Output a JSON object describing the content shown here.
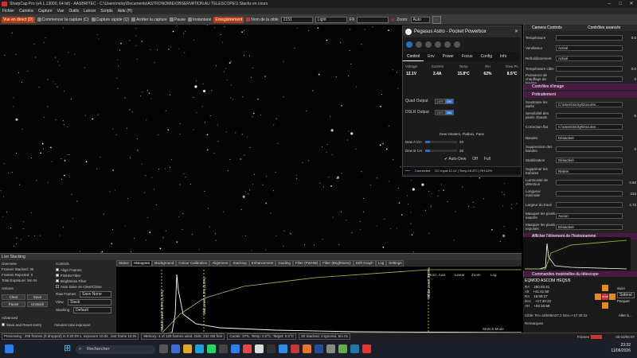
{
  "window": {
    "title": "SharpCap Pro (v4.1.13000, 64 bit) - AASBRITEC - C:\\Users\\nicky\\Documents\\ASTRONOMIE\\OBSERVATION AU TELESCOPE\\1 Stacks en cours"
  },
  "menu": [
    "Fichier",
    "Caméra",
    "Capture",
    "Vue",
    "Outils",
    "Lancer",
    "Scripts",
    "Aide (H)"
  ],
  "toolbar": {
    "live": "Vue en direct (D)",
    "start_capture": "Commencer la capture (C)",
    "quick_capture": "Capture rapide (Q)",
    "stop_capture": "Arrêter la capture",
    "pause": "Pause",
    "snapshot": "Instantané",
    "record": "Enregistrement",
    "target_label": "Nom de la cible",
    "target_value": "2151",
    "light": "Light",
    "fx_label": "FX",
    "zoom_label": "Zoom:",
    "zoom_value": "Auto"
  },
  "pegasus": {
    "title": "Pegasus Astro - Pocket Powerbox",
    "tabs": [
      "Control",
      "Env",
      "Power",
      "Focus",
      "Config",
      "Info"
    ],
    "metrics": [
      {
        "label": "Voltage",
        "value": "12.1V"
      },
      {
        "label": "Current",
        "value": "2.4A"
      },
      {
        "label": "Temp",
        "value": "15.8°C"
      },
      {
        "label": "RH",
        "value": "62%"
      },
      {
        "label": "Dew Pt.",
        "value": "8.5°C"
      }
    ],
    "quad_output": "Quad Output",
    "dslr_output": "DSLR Output",
    "off": "OFF",
    "on": "ON",
    "dew_title": "Dew Heaters, Flatbox, Fans",
    "dew_a": "Dew A CH",
    "dew_b": "Dew B CH",
    "dew_a_val": "28",
    "dew_b_val": "28",
    "auto_dew": "Auto-Dew",
    "off_btn": "Off",
    "full_btn": "Full",
    "status_connected": "Connected",
    "status_info": "DC Input:12.1V | Temp:15.8°C | RH:62%"
  },
  "right": {
    "camera_controls": "Camera Controls",
    "show_advanced": "Contrôles avancés",
    "rows": [
      {
        "label": "Température",
        "value": "",
        "num": "0.0"
      },
      {
        "label": "Ventilateur",
        "value": "Activé",
        "num": ""
      },
      {
        "label": "Refroidissement",
        "value": "Activé",
        "num": ""
      },
      {
        "label": "Température cible",
        "value": "",
        "num": "0.0"
      },
      {
        "label": "Puissance de chauffage de fenêtre",
        "value": "",
        "num": "0"
      }
    ],
    "image_controls": "Contrôles d'image",
    "preprocessing": "Prétraitement",
    "rows2": [
      {
        "label": "Soustraire les darks",
        "value": "C:\\Users\\nicky\\Docume...",
        "num": ""
      },
      {
        "label": "Sensibilité des pixels chauds",
        "value": "",
        "num": "5"
      },
      {
        "label": "Correction flat",
        "value": "C:\\Users\\nicky\\Docume...",
        "num": ""
      },
      {
        "label": "Bandes",
        "value": "Désactivé",
        "num": ""
      },
      {
        "label": "Suppression des bandes",
        "value": "",
        "num": "0"
      },
      {
        "label": "Stabilisation",
        "value": "Désactivé",
        "num": ""
      },
      {
        "label": "Supprimer les traînées",
        "value": "Retirer",
        "num": ""
      },
      {
        "label": "Luminosité de détection",
        "value": "",
        "num": "0.60"
      },
      {
        "label": "Longueur minimale",
        "value": "",
        "num": "234"
      },
      {
        "label": "Largeur du tracé",
        "value": "",
        "num": "4.72"
      },
      {
        "label": "Masquer les pixels saturés",
        "value": "Aucun",
        "num": ""
      },
      {
        "label": "Masquer les pixels exposés",
        "value": "Désactivé",
        "num": ""
      }
    ],
    "histogram_section": "Afficher l'étirement de l'histogramme",
    "telescope_section": "Commandes matérielles du télescope",
    "mount": "EQMOD ASCOM HEQ5/6",
    "ra": "RA",
    "ra_val": "250:45:41",
    "alt": "Alt",
    "alt_val": "+41:41:50",
    "ra2": "RA",
    "ra2_val": "16:09:27",
    "dec": "Dec",
    "dec_val": "+17:40:42",
    "ah": "AH",
    "ah_val": "+03:10:58",
    "track": "Suivi",
    "track_val": "Sidéral",
    "goto": "Aller à...",
    "stop": "STOP",
    "cible": "Cible: RA=16h09m27.2 Dec=+17:40:42",
    "park": "Parquer",
    "remarques": "Remarques"
  },
  "livestack": {
    "title": "Live Stacking",
    "overview": "Overview",
    "frames_stacked": "Frames Stacked:",
    "frames_stacked_val": "30",
    "frames_rejected": "Frames Rejected:",
    "frames_rejected_val": "0",
    "total_exposure": "Total Exposure:",
    "total_exposure_val": "5m 0s",
    "controls": "Controls",
    "align": "Align Frames",
    "fwhm": "FWHM Filter",
    "brightness": "Brightness Filter",
    "autosave": "Auto Save on Clear/Close",
    "raw_frames": "Raw Frames",
    "raw_val": "Save None",
    "view": "View",
    "view_val": "Stack",
    "stacking": "Stacking",
    "stacking_val": "Default",
    "actions": "Actions",
    "clear": "Clear",
    "save": "Save",
    "pause": "Pause",
    "unstack": "Unstack",
    "advanced": "Advanced",
    "save_reset": "Save and Reset every",
    "minutes": "minutes total exposure",
    "tabs": [
      "Status",
      "Histogram",
      "Background",
      "Colour Calibration",
      "Alignment",
      "Stacking",
      "Enhancement",
      "Guiding",
      "Filter (FWHM)",
      "Filter (Brightness)",
      "Drift Graph",
      "Log",
      "Settings"
    ],
    "horiz_axis": "Horiz. Axis:",
    "horiz_val": "Linear",
    "zoom": "Zoom",
    "log": "Log",
    "black_label": "Black Level: 0.0% (1.4%)",
    "mid_label": "Mid Level: 5.5% (5.0%)",
    "white_label": "White Level: 28.5%",
    "stretch_mode": "Stretch Mode"
  },
  "statusbar": {
    "preview": "Previewing : 298 frames (0 dropped) in 0:20:09 s, exposure 10.0s , last frame 10.0s",
    "memory": "Memory: 4 of 129 frames used, Disk: 232 GB free",
    "cooler": "Cooler: 37%, Temp: 0.0°C, Target: 0.0°C",
    "stacked": "30 Stacked, 0 Ignored, 5m 0s",
    "frames": "Frames",
    "frames_count": "00:03/00:07"
  },
  "taskbar": {
    "search": "Rechercher",
    "time": "23:32",
    "date": "11/06/2026"
  },
  "colors": {
    "accent": "#b33a14",
    "magenta": "#8a1e7a",
    "blue": "#2a6fbf",
    "orange": "#e58a1f",
    "green": "#a4c93a"
  }
}
